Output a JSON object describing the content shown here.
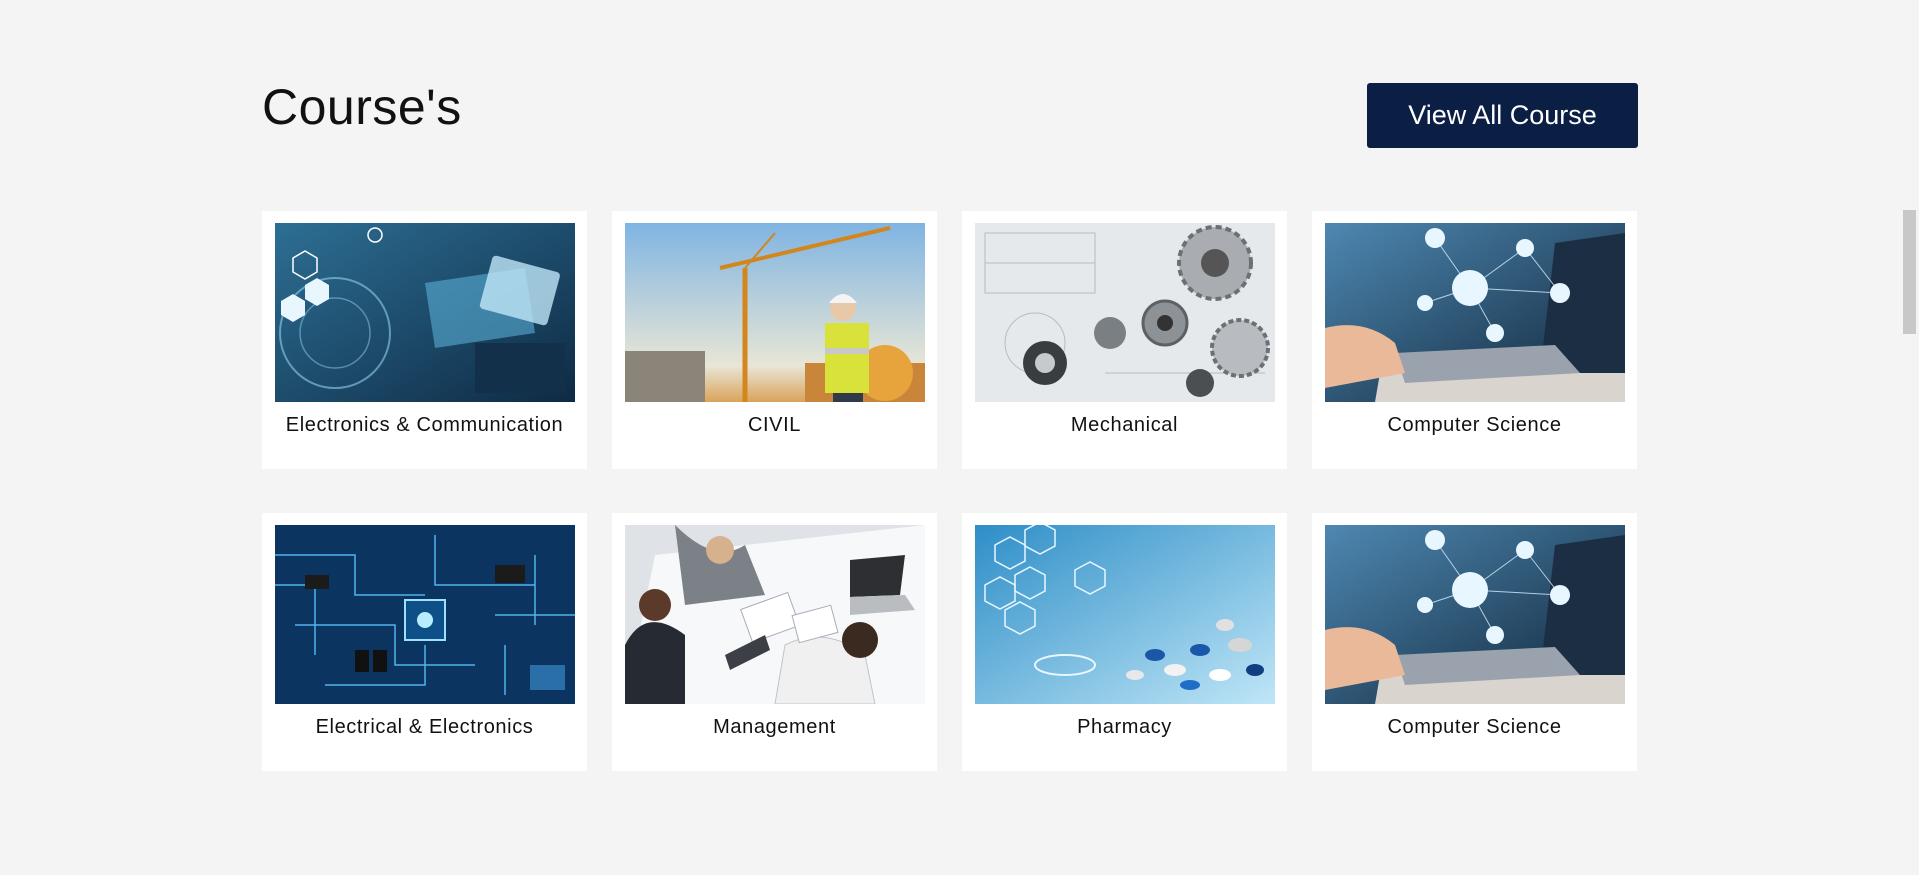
{
  "section": {
    "title": "Course's",
    "view_all_label": "View All Course"
  },
  "courses": [
    {
      "label": "Electronics & Communication",
      "image": "industrial-tablet-image"
    },
    {
      "label": "CIVIL",
      "image": "construction-crane-image"
    },
    {
      "label": "Mechanical",
      "image": "gears-blueprint-image"
    },
    {
      "label": "Computer Science",
      "image": "laptop-network-image"
    },
    {
      "label": "Electrical & Electronics",
      "image": "circuit-board-image"
    },
    {
      "label": "Management",
      "image": "business-meeting-image"
    },
    {
      "label": "Pharmacy",
      "image": "pills-lab-image"
    },
    {
      "label": "Computer Science",
      "image": "laptop-network-image"
    }
  ],
  "colors": {
    "background": "#f4f4f4",
    "card": "#ffffff",
    "button": "#0b1f45"
  }
}
